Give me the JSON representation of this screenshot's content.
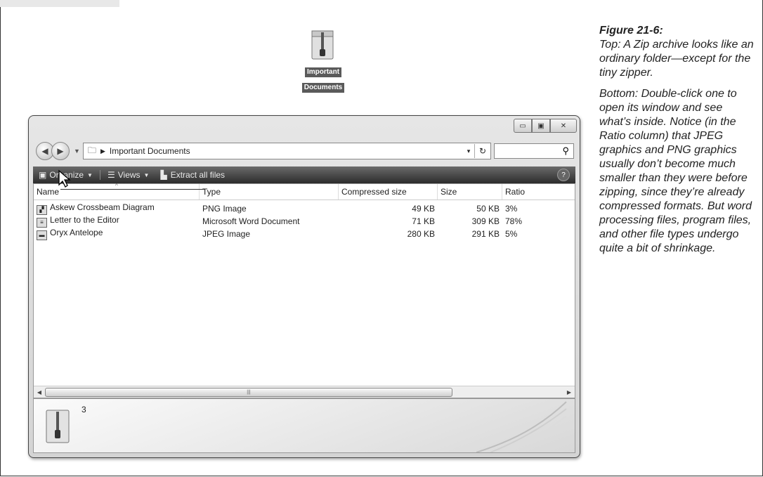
{
  "desktop_icon": {
    "label_line1": "Important",
    "label_line2": "Documents",
    "icon": "zip-folder-icon"
  },
  "window": {
    "controls": {
      "minimize": "▭",
      "maximize": "▣",
      "close": "✕"
    },
    "address": {
      "path_label": "Important Documents",
      "dropdown": "▾",
      "refresh": "↻"
    },
    "search": {
      "placeholder": "",
      "icon": "search-icon"
    },
    "toolbar": {
      "organize": "Organize",
      "views": "Views",
      "extract": "Extract all files",
      "help": "?"
    },
    "columns": [
      "Name",
      "Type",
      "Compressed size",
      "Size",
      "Ratio"
    ],
    "files": [
      {
        "name": "Askew Crossbeam Diagram",
        "type": "PNG Image",
        "compressed": "49 KB",
        "size": "50 KB",
        "ratio": "3%",
        "icon": "png-file-icon"
      },
      {
        "name": "Letter to the Editor",
        "type": "Microsoft Word Document",
        "compressed": "71 KB",
        "size": "309 KB",
        "ratio": "78%",
        "icon": "word-file-icon"
      },
      {
        "name": "Oryx Antelope",
        "type": "JPEG Image",
        "compressed": "280 KB",
        "size": "291 KB",
        "ratio": "5%",
        "icon": "jpeg-file-icon"
      }
    ],
    "details": {
      "count": "3"
    }
  },
  "caption": {
    "title": "Figure 21-6:",
    "para1": "Top: A Zip archive looks like an ordinary folder—except for the tiny zipper.",
    "para2": "Bottom: Double-click one to open its window and see what’s inside. Notice (in the Ratio column) that JPEG graphics and PNG graphics usually don’t become much smaller than they were before zipping, since they’re already compressed formats. But word processing files, program files, and other file types undergo quite a bit of shrinkage."
  }
}
